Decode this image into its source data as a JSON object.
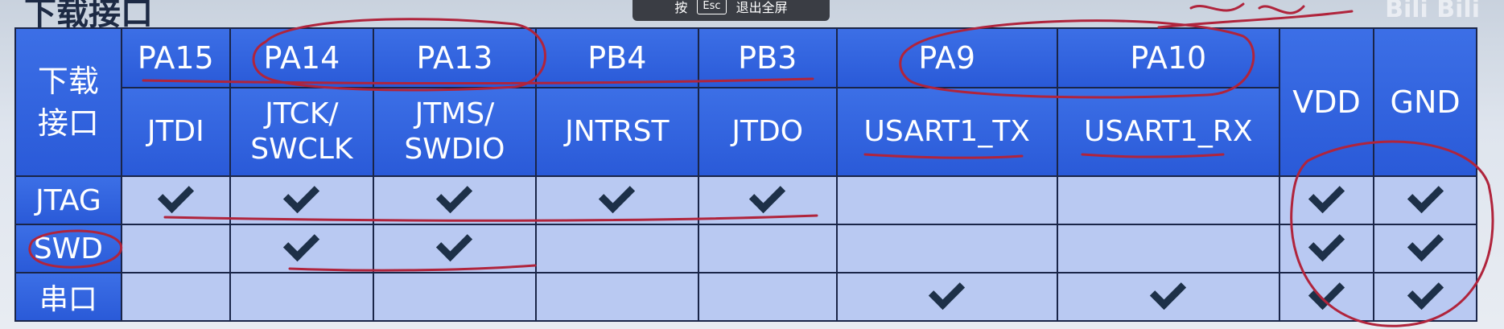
{
  "window": {
    "title_fragment": "下载接口",
    "esc_hint": {
      "prefix": "按",
      "key": "Esc",
      "suffix": "退出全屏"
    },
    "watermark": "Bili Bili"
  },
  "table": {
    "corner_label": "下载\n接口",
    "pins": [
      "PA15",
      "PA14",
      "PA13",
      "PB4",
      "PB3",
      "PA9",
      "PA10"
    ],
    "functions": [
      "JTDI",
      "JTCK/\nSWCLK",
      "JTMS/\nSWDIO",
      "JNTRST",
      "JTDO",
      "USART1_TX",
      "USART1_RX"
    ],
    "power": [
      "VDD",
      "GND"
    ],
    "rows": [
      {
        "label": "JTAG",
        "checks": [
          true,
          true,
          true,
          true,
          true,
          false,
          false,
          true,
          true
        ]
      },
      {
        "label": "SWD",
        "checks": [
          false,
          true,
          true,
          false,
          false,
          false,
          false,
          true,
          true
        ]
      },
      {
        "label": "串口",
        "checks": [
          false,
          false,
          false,
          false,
          false,
          true,
          true,
          true,
          true
        ]
      }
    ],
    "annotation_text": "串口"
  },
  "colors": {
    "header_blue": "#2f62de",
    "cell_light_blue": "#b9c9f2",
    "grid_line": "#1a2548",
    "ink_red": "#b0243c"
  }
}
